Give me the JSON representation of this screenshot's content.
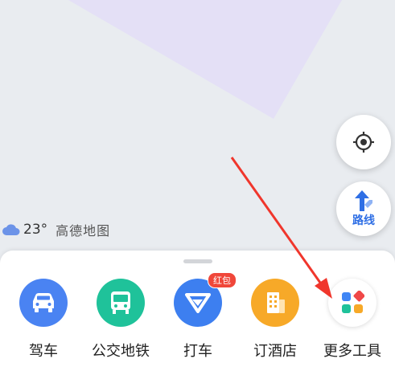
{
  "map": {
    "brand": "高德地图"
  },
  "weather": {
    "temperature": "23°",
    "icon": "cloud-icon"
  },
  "controls": {
    "route_label": "路线"
  },
  "tools": [
    {
      "label": "驾车",
      "icon": "car-icon",
      "color": "#4a83f2"
    },
    {
      "label": "公交地铁",
      "icon": "bus-icon",
      "color": "#1fc29a"
    },
    {
      "label": "打车",
      "icon": "taxi-icon",
      "color": "#3d7ff0",
      "badge": "红包"
    },
    {
      "label": "订酒店",
      "icon": "hotel-icon",
      "color": "#f7a928"
    },
    {
      "label": "更多工具",
      "icon": "more-tools-icon",
      "color": "#ffffff"
    }
  ],
  "annotation": {
    "color": "#f0362c"
  }
}
